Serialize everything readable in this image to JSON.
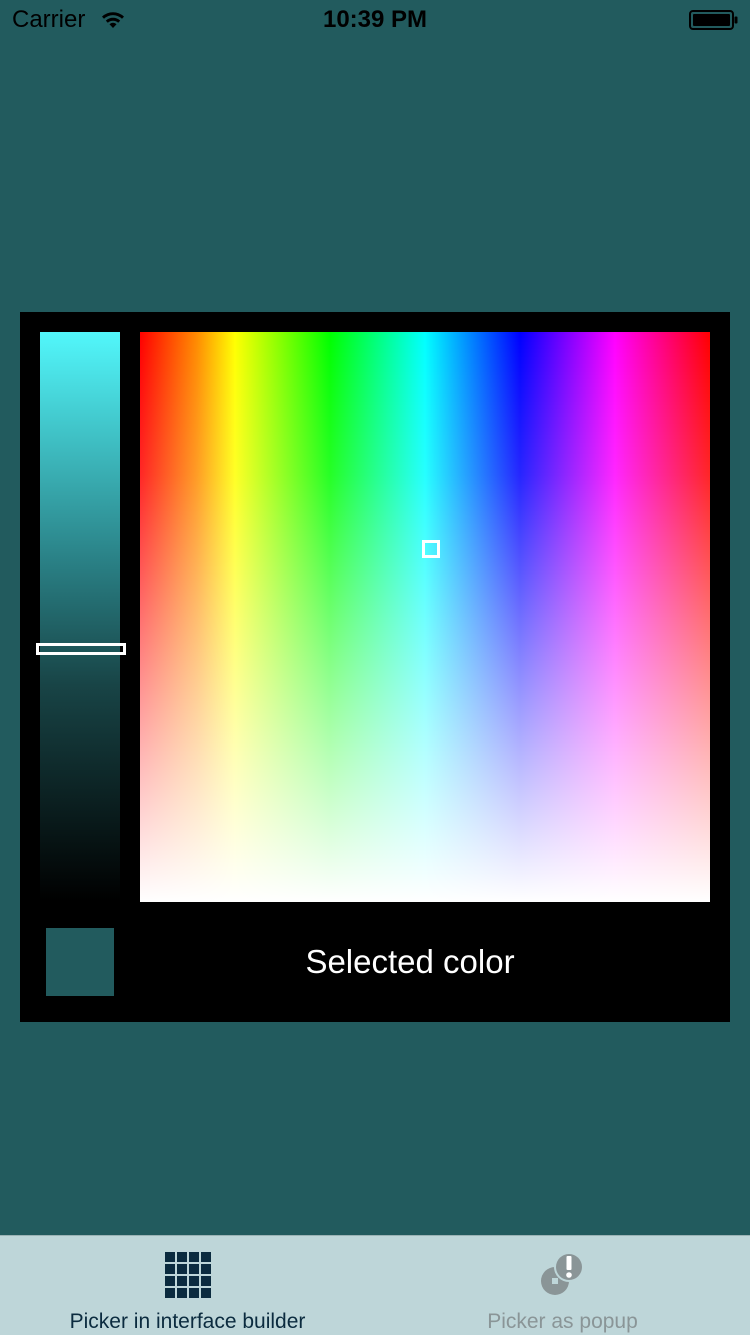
{
  "status_bar": {
    "carrier": "Carrier",
    "time": "10:39 PM",
    "wifi_icon": "wifi-icon",
    "battery_icon": "battery-icon"
  },
  "picker": {
    "selected_label": "Selected color",
    "selected_color": "#225b5e",
    "brightness_icon": "brightness-slider",
    "cursor_icon": "square-cursor-icon"
  },
  "tab_bar": {
    "tabs": [
      {
        "label": "Picker in interface builder",
        "icon": "grid-icon",
        "selected": true
      },
      {
        "label": "Picker as popup",
        "icon": "popup-alert-icon",
        "selected": false
      }
    ]
  },
  "colors": {
    "background": "#225b5e",
    "panel": "#000000",
    "tab_bar": "#bed6d9",
    "tab_active": "#0b2b3f",
    "tab_inactive": "#8a9597"
  }
}
